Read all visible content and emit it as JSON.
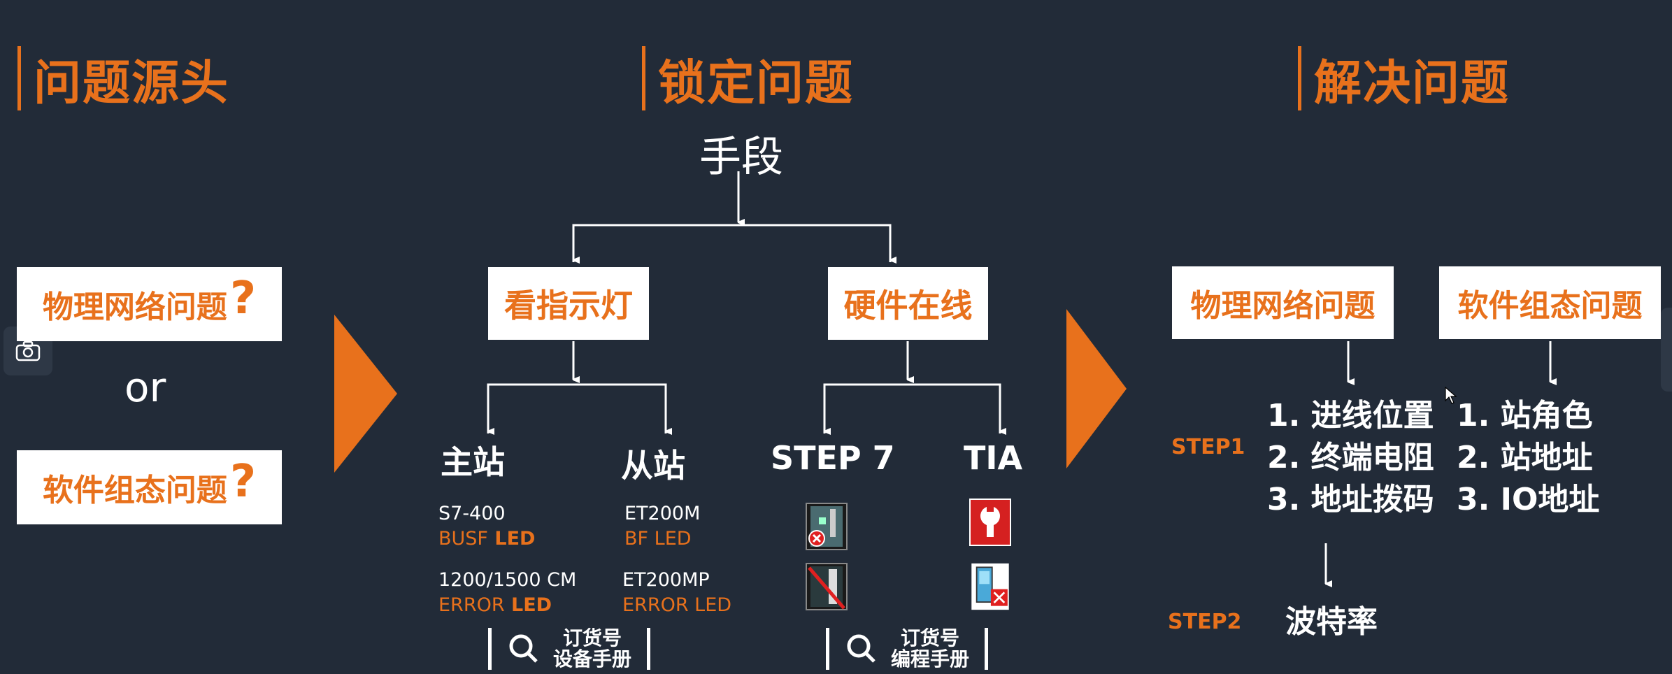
{
  "headings": {
    "source": "问题源头",
    "lock": "锁定问题",
    "solve": "解决问题"
  },
  "source": {
    "physical": "物理网络问题",
    "software": "软件组态问题",
    "qmark": "?",
    "or": "or"
  },
  "lock": {
    "means": "手段",
    "indicator": "看指示灯",
    "hardware_online": "硬件在线",
    "master": "主站",
    "slave": "从站",
    "step7": "STEP 7",
    "tia": "TIA",
    "master_items": [
      {
        "model": "S7-400",
        "led_prefix": "BUSF",
        "led_suffix": " LED"
      },
      {
        "model": "1200/1500 CM",
        "led_prefix": "ERROR",
        "led_suffix": " LED"
      }
    ],
    "slave_items": [
      {
        "model": "ET200M",
        "led_prefix": "BF",
        "led_suffix": " LED"
      },
      {
        "model": "ET200MP",
        "led_prefix": "ERROR",
        "led_suffix": " LED"
      }
    ],
    "search_left": {
      "line1": "订货号",
      "line2": "设备手册"
    },
    "search_right": {
      "line1": "订货号",
      "line2": "编程手册"
    }
  },
  "solve": {
    "physical": "物理网络问题",
    "software": "软件组态问题",
    "step1_label": "STEP1",
    "step2_label": "STEP2",
    "physical_steps": [
      "1. 进线位置",
      "2. 终端电阻",
      "3. 地址拨码"
    ],
    "software_steps": [
      "1. 站角色",
      "2. 站地址",
      "3. IO地址"
    ],
    "step2_value": "波特率"
  },
  "icons": {
    "camera": "camera-icon",
    "magnifier": "magnifier-icon",
    "accent": "#e8711c",
    "background": "#222b38"
  }
}
